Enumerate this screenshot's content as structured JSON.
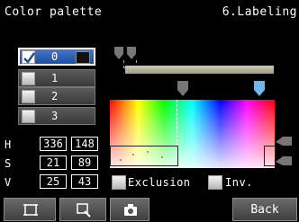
{
  "header": {
    "title": "Color palette",
    "section": "6.Labeling"
  },
  "palette": {
    "items": [
      {
        "label": "0",
        "checked": true,
        "swatch_color": "#111111"
      },
      {
        "label": "1",
        "checked": false
      },
      {
        "label": "2",
        "checked": false
      },
      {
        "label": "3",
        "checked": false
      }
    ]
  },
  "hsv": {
    "rows": [
      {
        "label": "H",
        "min": "336",
        "max": "148"
      },
      {
        "label": "S",
        "min": "21",
        "max": "89"
      },
      {
        "label": "V",
        "min": "25",
        "max": "43"
      }
    ]
  },
  "options": {
    "exclusion_label": "Exclusion",
    "inv_label": "Inv."
  },
  "footer": {
    "back_label": "Back"
  },
  "colors": {
    "selected_item": "#2c5fb3",
    "button": "#555555",
    "slider": "#b8b39a"
  }
}
